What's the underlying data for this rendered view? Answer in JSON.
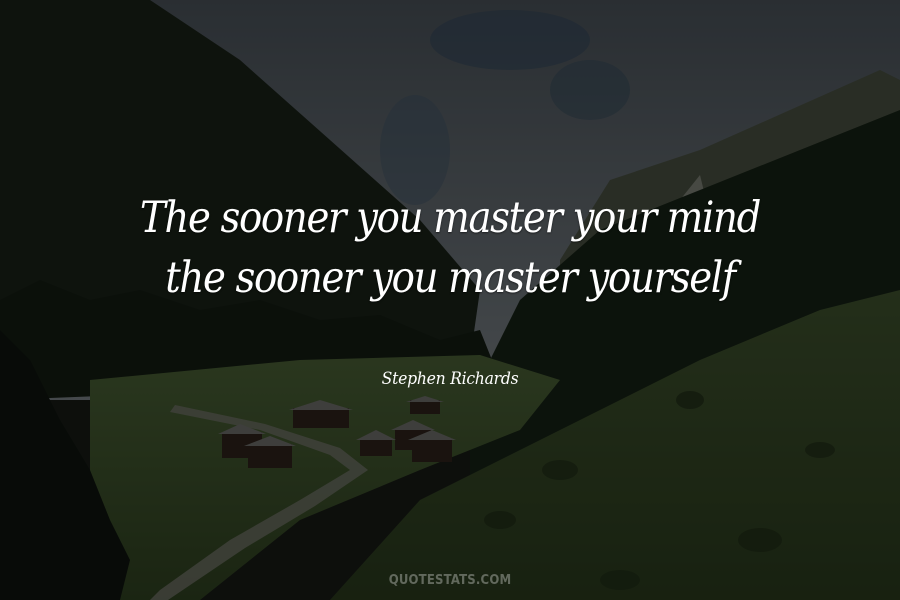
{
  "quote": {
    "lines": [
      "The sooner you master your mind",
      "the sooner you master yourself"
    ]
  },
  "author": "Stephen Richards",
  "watermark": "QUOTESTATS.COM",
  "colors": {
    "overlay": "#000000",
    "text": "#ffffff",
    "sky": "#7a8894",
    "forest": "#1c2a1c",
    "meadow": "#4f6a3a"
  }
}
